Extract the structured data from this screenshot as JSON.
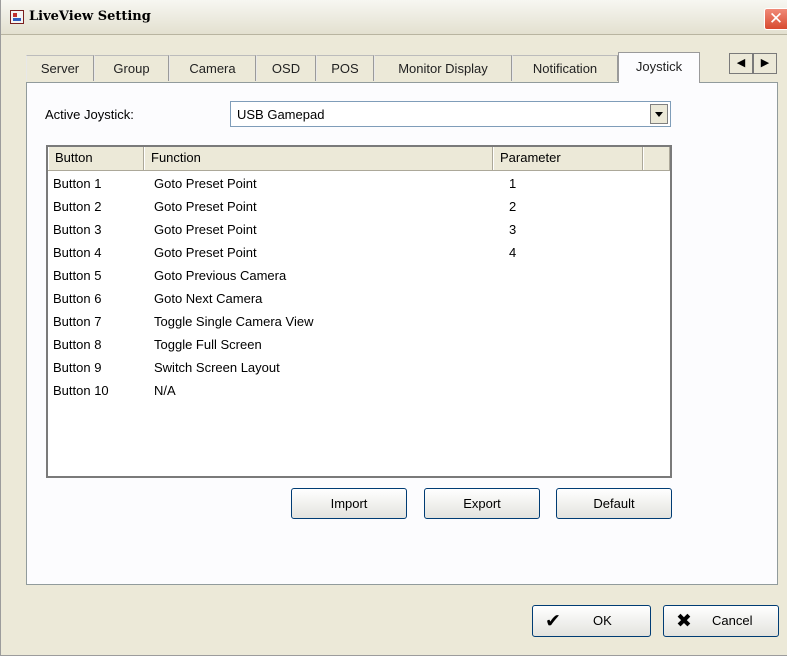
{
  "window": {
    "title": "LiveView Setting"
  },
  "tabs": [
    "Server",
    "Group",
    "Camera",
    "OSD",
    "POS",
    "Monitor Display",
    "Notification",
    "Joystick"
  ],
  "active_tab": "Joystick",
  "joystick": {
    "label": "Active Joystick:",
    "selected": "USB Gamepad"
  },
  "table": {
    "headers": [
      "Button",
      "Function",
      "Parameter"
    ],
    "rows": [
      [
        "Button 1",
        "Goto Preset Point",
        "1"
      ],
      [
        "Button 2",
        "Goto Preset Point",
        "2"
      ],
      [
        "Button 3",
        "Goto Preset Point",
        "3"
      ],
      [
        "Button 4",
        "Goto Preset Point",
        "4"
      ],
      [
        "Button 5",
        "Goto Previous Camera",
        ""
      ],
      [
        "Button 6",
        "Goto Next Camera",
        ""
      ],
      [
        "Button 7",
        "Toggle Single Camera View",
        ""
      ],
      [
        "Button 8",
        "Toggle Full Screen",
        ""
      ],
      [
        "Button 9",
        "Switch Screen Layout",
        ""
      ],
      [
        "Button 10",
        "N/A",
        ""
      ]
    ]
  },
  "actions": {
    "import": "Import",
    "export": "Export",
    "default": "Default"
  },
  "dialog": {
    "ok": "OK",
    "cancel": "Cancel"
  }
}
